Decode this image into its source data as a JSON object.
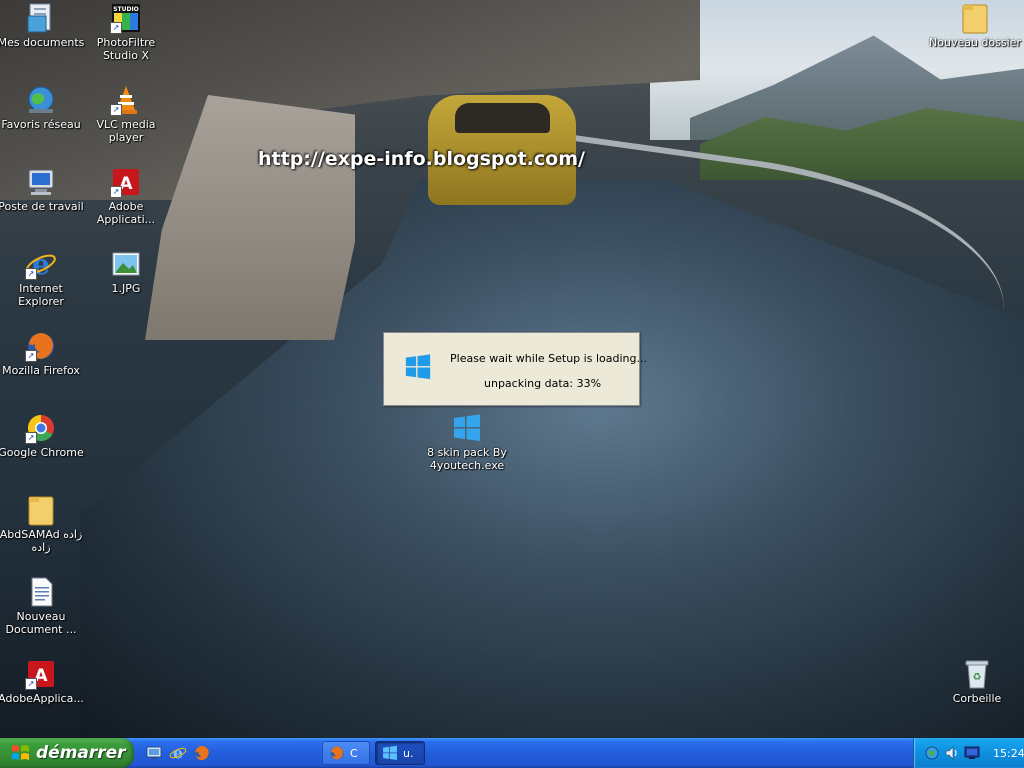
{
  "desktop": {
    "watermark": "http://expe-info.blogspot.com/",
    "icons": {
      "mes_documents": "Mes documents",
      "photofiltre": [
        "PhotoFiltre",
        "Studio X"
      ],
      "favoris_reseau": "Favoris réseau",
      "vlc": [
        "VLC media",
        "player"
      ],
      "poste_de_travail": "Poste de travail",
      "adobe_applications": [
        "Adobe",
        "Applicati..."
      ],
      "internet_explorer": [
        "Internet",
        "Explorer"
      ],
      "jpg_file": "1.JPG",
      "mozilla_firefox": "Mozilla Firefox",
      "google_chrome": "Google Chrome",
      "abdsamad_folder": [
        "AbdSAMAd زاده",
        "زاده"
      ],
      "nouveau_document": [
        "Nouveau",
        "Document ..."
      ],
      "adobe_applica": "AdobeApplica...",
      "skin_pack": [
        "8 skin pack By",
        "4youtech.exe"
      ],
      "nouveau_dossier": "Nouveau dossier",
      "corbeille": "Corbeille"
    }
  },
  "setup_dialog": {
    "message": "Please wait while Setup is loading...",
    "progress_text": "unpacking data: 33%",
    "progress_percent": 33
  },
  "taskbar": {
    "start_label": "démarrer",
    "quick_launch": [
      "show-desktop-icon",
      "internet-explorer-icon",
      "firefox-icon"
    ],
    "tasks": [
      {
        "label": "C",
        "icon": "firefox-icon"
      },
      {
        "label": "u.",
        "icon": "windows-logo-icon",
        "active": true
      }
    ],
    "tray_icons": [
      "network-icon",
      "volume-icon",
      "display-icon"
    ],
    "clock": "15:24"
  },
  "colors": {
    "taskbar_blue": "#245edb",
    "start_green": "#368e35",
    "tray_blue": "#0e8fdf",
    "dialog_bg": "#ece9d8"
  }
}
